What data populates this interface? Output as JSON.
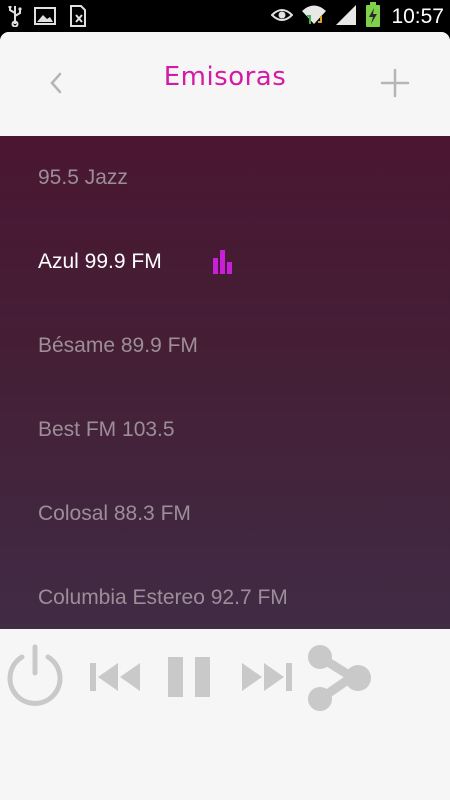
{
  "status_bar": {
    "time": "10:57",
    "left_icons": [
      "usb-icon",
      "image-icon",
      "sim-icon"
    ],
    "right_icons": [
      "eye-icon",
      "wifi-icon",
      "signal-icon",
      "battery-charging-icon"
    ]
  },
  "header": {
    "title": "Emisoras",
    "back_icon": "chevron-left-icon",
    "add_icon": "plus-icon"
  },
  "stations": [
    {
      "label": "95.5 Jazz",
      "active": false
    },
    {
      "label": "Azul 99.9 FM",
      "active": true
    },
    {
      "label": "Bésame 89.9 FM",
      "active": false
    },
    {
      "label": "Best FM 103.5",
      "active": false
    },
    {
      "label": "Colosal 88.3 FM",
      "active": false
    },
    {
      "label": "Columbia Estereo 92.7 FM",
      "active": false
    }
  ],
  "player": {
    "controls": [
      "power-icon",
      "previous-icon",
      "pause-icon",
      "next-icon",
      "share-icon"
    ]
  },
  "colors": {
    "accent": "#d41aa6",
    "playing_indicator": "#c820d8",
    "list_bg_top": "#4a1632",
    "list_bg_bottom": "#412b45",
    "inactive_text": "#9c8e98",
    "active_text": "#ffffff",
    "control_gray": "#c9c9c9"
  }
}
